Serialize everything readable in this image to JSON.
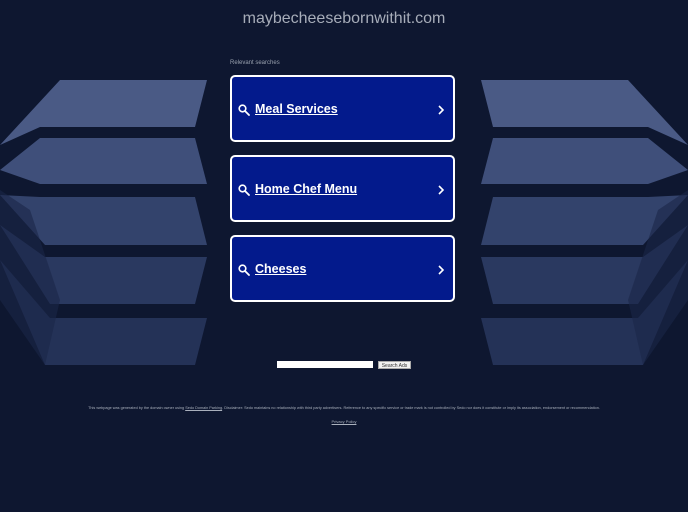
{
  "colors": {
    "background": "#0e1730",
    "card_fill": "#031a8c",
    "card_border": "#ffffff",
    "text_muted": "#a7adb9"
  },
  "header": {
    "domain": "maybecheesebornwithit.com"
  },
  "results": {
    "heading": "Relevant searches",
    "items": [
      {
        "label": "Meal Services",
        "icon": "search-icon",
        "chevron": "chevron-right-icon"
      },
      {
        "label": "Home Chef Menu",
        "icon": "search-icon",
        "chevron": "chevron-right-icon"
      },
      {
        "label": "Cheeses",
        "icon": "search-icon",
        "chevron": "chevron-right-icon"
      }
    ]
  },
  "search": {
    "input_value": "",
    "button_label": "Search Ads"
  },
  "footer": {
    "text_before": "This webpage was generated by the domain owner using ",
    "link_text": "Sedo Domain Parking",
    "text_after": ". Disclaimer: Sedo maintains no relationship with third party advertisers. Reference to any specific service or trade mark is not controlled by Sedo nor does it constitute or imply its association, endorsement or recommendation.",
    "privacy_label": "Privacy Policy"
  }
}
